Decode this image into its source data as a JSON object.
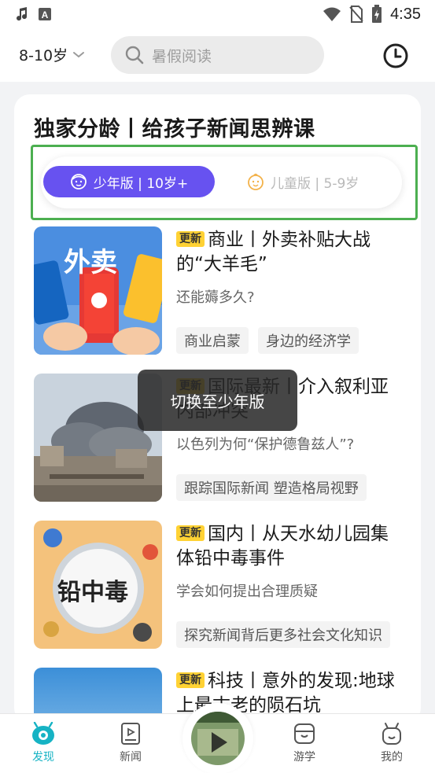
{
  "status": {
    "time": "4:35"
  },
  "topbar": {
    "age_range": "8-10岁",
    "search_placeholder": "暑假阅读"
  },
  "card": {
    "title": "独家分龄丨给孩子新闻思辨课",
    "toggle": {
      "active_label": "少年版 | 10岁+",
      "inactive_label": "儿童版 | 5-9岁"
    }
  },
  "news": [
    {
      "badge": "更新",
      "title": "商业丨外卖补贴大战的“大羊毛”",
      "subtitle": "还能薅多久?",
      "tags": [
        "商业启蒙",
        "身边的经济学"
      ],
      "thumb_text": "外卖"
    },
    {
      "badge": "更新",
      "title": "国际最新丨介入叙利亚内部冲突",
      "subtitle": "以色列为何“保护德鲁兹人”?",
      "tags": [
        "跟踪国际新闻 塑造格局视野"
      ]
    },
    {
      "badge": "更新",
      "title": "国内丨从天水幼儿园集体铅中毒事件",
      "subtitle": "学会如何提出合理质疑",
      "tags": [
        "探究新闻背后更多社会文化知识"
      ],
      "thumb_text": "铅中毒"
    },
    {
      "badge": "更新",
      "title": "科技丨意外的发现:地球上最古老的陨石坑",
      "subtitle": "",
      "tags": []
    }
  ],
  "toast": "切换至少年版",
  "bottom_nav": {
    "items": [
      {
        "label": "发现",
        "icon": "discover-icon",
        "active": true
      },
      {
        "label": "新闻",
        "icon": "news-icon",
        "active": false
      },
      {
        "label": "游学",
        "icon": "study-tour-icon",
        "active": false
      },
      {
        "label": "我的",
        "icon": "profile-icon",
        "active": false
      }
    ]
  },
  "colors": {
    "accent": "#6752f0",
    "nav_active": "#16b3c4",
    "badge": "#ffd234",
    "highlight": "#4caf50"
  }
}
